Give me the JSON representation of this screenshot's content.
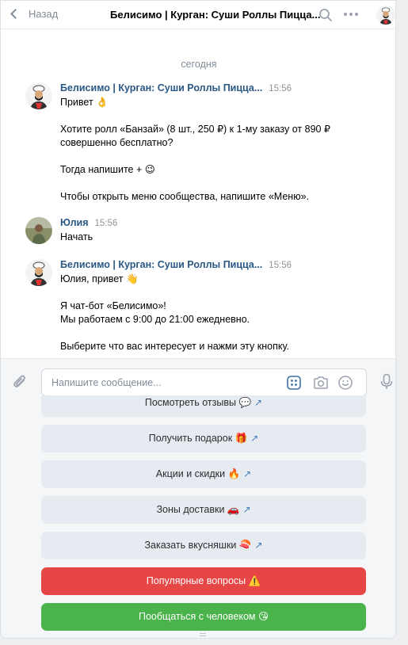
{
  "header": {
    "back_label": "Назад",
    "title": "Белисимо | Курган: Суши Роллы Пицца..."
  },
  "chat": {
    "date_separator": "сегодня",
    "messages": [
      {
        "author": "Белисимо | Курган: Суши Роллы Пицца...",
        "time": "15:56",
        "lines": [
          "Привет 👌",
          "",
          "Хотите ролл «Банзай» (8 шт., 250 ₽) к 1-му заказу от 890 ₽",
          "совершенно бесплатно?",
          "",
          "Тогда напишите + 😉",
          "",
          "Чтобы открыть меню сообщества, напишите «Меню»."
        ]
      },
      {
        "author": "Юлия",
        "time": "15:56",
        "lines": [
          "Начать"
        ]
      },
      {
        "author": "Белисимо | Курган: Суши Роллы Пицца...",
        "time": "15:56",
        "lines": [
          "Юлия, привет 👋",
          "",
          "Я чат-бот «Белисимо»!",
          "Мы работаем с 9:00 до 21:00 ежедневно.",
          "",
          "Выберите что вас интересует и нажми эту кнопку."
        ]
      }
    ]
  },
  "composer": {
    "placeholder": "Напишите сообщение..."
  },
  "keyboard": {
    "buttons": [
      {
        "label": "Посмотреть отзывы 💬",
        "link_icon": "↗"
      },
      {
        "label": "Получить подарок 🎁",
        "link_icon": "↗"
      },
      {
        "label": "Акции и скидки 🔥",
        "link_icon": "↗"
      },
      {
        "label": "Зоны доставки 🚗",
        "link_icon": "↗"
      },
      {
        "label": "Заказать вкусняшки 🍣",
        "link_icon": "↗"
      },
      {
        "label": "Популярные вопросы ⚠️"
      },
      {
        "label": "Пообщаться с человеком 😘"
      }
    ],
    "colors": {
      "secondary": "#e5ebf1",
      "negative": "#e64646",
      "positive": "#4bb34b",
      "link": "#447bba"
    }
  },
  "icons": {
    "back": "chevron-left-icon",
    "search": "search-icon",
    "more": "more-horizontal-icon",
    "attach": "paperclip-icon",
    "bot_keyboard": "keyboard-grid-icon",
    "camera": "camera-icon",
    "emoji": "smile-icon",
    "voice": "microphone-icon"
  }
}
